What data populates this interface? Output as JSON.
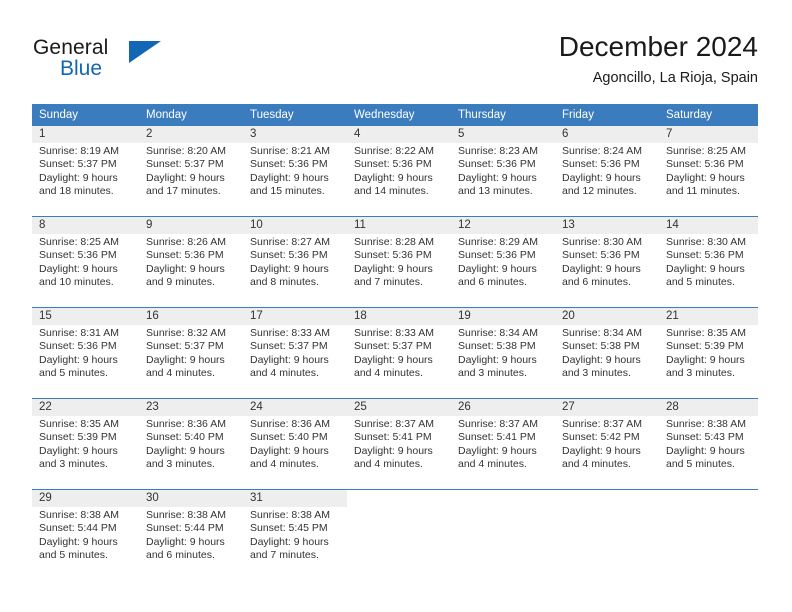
{
  "brand": {
    "name_part1": "General",
    "name_part2": "Blue",
    "flag_icon": "triangle-flag-icon"
  },
  "header": {
    "title": "December 2024",
    "location": "Agoncillo, La Rioja, Spain"
  },
  "calendar": {
    "weekday_headers": [
      "Sunday",
      "Monday",
      "Tuesday",
      "Wednesday",
      "Thursday",
      "Friday",
      "Saturday"
    ],
    "weeks": [
      [
        {
          "day": "1",
          "sunrise": "Sunrise: 8:19 AM",
          "sunset": "Sunset: 5:37 PM",
          "daylight_1": "Daylight: 9 hours",
          "daylight_2": "and 18 minutes."
        },
        {
          "day": "2",
          "sunrise": "Sunrise: 8:20 AM",
          "sunset": "Sunset: 5:37 PM",
          "daylight_1": "Daylight: 9 hours",
          "daylight_2": "and 17 minutes."
        },
        {
          "day": "3",
          "sunrise": "Sunrise: 8:21 AM",
          "sunset": "Sunset: 5:36 PM",
          "daylight_1": "Daylight: 9 hours",
          "daylight_2": "and 15 minutes."
        },
        {
          "day": "4",
          "sunrise": "Sunrise: 8:22 AM",
          "sunset": "Sunset: 5:36 PM",
          "daylight_1": "Daylight: 9 hours",
          "daylight_2": "and 14 minutes."
        },
        {
          "day": "5",
          "sunrise": "Sunrise: 8:23 AM",
          "sunset": "Sunset: 5:36 PM",
          "daylight_1": "Daylight: 9 hours",
          "daylight_2": "and 13 minutes."
        },
        {
          "day": "6",
          "sunrise": "Sunrise: 8:24 AM",
          "sunset": "Sunset: 5:36 PM",
          "daylight_1": "Daylight: 9 hours",
          "daylight_2": "and 12 minutes."
        },
        {
          "day": "7",
          "sunrise": "Sunrise: 8:25 AM",
          "sunset": "Sunset: 5:36 PM",
          "daylight_1": "Daylight: 9 hours",
          "daylight_2": "and 11 minutes."
        }
      ],
      [
        {
          "day": "8",
          "sunrise": "Sunrise: 8:25 AM",
          "sunset": "Sunset: 5:36 PM",
          "daylight_1": "Daylight: 9 hours",
          "daylight_2": "and 10 minutes."
        },
        {
          "day": "9",
          "sunrise": "Sunrise: 8:26 AM",
          "sunset": "Sunset: 5:36 PM",
          "daylight_1": "Daylight: 9 hours",
          "daylight_2": "and 9 minutes."
        },
        {
          "day": "10",
          "sunrise": "Sunrise: 8:27 AM",
          "sunset": "Sunset: 5:36 PM",
          "daylight_1": "Daylight: 9 hours",
          "daylight_2": "and 8 minutes."
        },
        {
          "day": "11",
          "sunrise": "Sunrise: 8:28 AM",
          "sunset": "Sunset: 5:36 PM",
          "daylight_1": "Daylight: 9 hours",
          "daylight_2": "and 7 minutes."
        },
        {
          "day": "12",
          "sunrise": "Sunrise: 8:29 AM",
          "sunset": "Sunset: 5:36 PM",
          "daylight_1": "Daylight: 9 hours",
          "daylight_2": "and 6 minutes."
        },
        {
          "day": "13",
          "sunrise": "Sunrise: 8:30 AM",
          "sunset": "Sunset: 5:36 PM",
          "daylight_1": "Daylight: 9 hours",
          "daylight_2": "and 6 minutes."
        },
        {
          "day": "14",
          "sunrise": "Sunrise: 8:30 AM",
          "sunset": "Sunset: 5:36 PM",
          "daylight_1": "Daylight: 9 hours",
          "daylight_2": "and 5 minutes."
        }
      ],
      [
        {
          "day": "15",
          "sunrise": "Sunrise: 8:31 AM",
          "sunset": "Sunset: 5:36 PM",
          "daylight_1": "Daylight: 9 hours",
          "daylight_2": "and 5 minutes."
        },
        {
          "day": "16",
          "sunrise": "Sunrise: 8:32 AM",
          "sunset": "Sunset: 5:37 PM",
          "daylight_1": "Daylight: 9 hours",
          "daylight_2": "and 4 minutes."
        },
        {
          "day": "17",
          "sunrise": "Sunrise: 8:33 AM",
          "sunset": "Sunset: 5:37 PM",
          "daylight_1": "Daylight: 9 hours",
          "daylight_2": "and 4 minutes."
        },
        {
          "day": "18",
          "sunrise": "Sunrise: 8:33 AM",
          "sunset": "Sunset: 5:37 PM",
          "daylight_1": "Daylight: 9 hours",
          "daylight_2": "and 4 minutes."
        },
        {
          "day": "19",
          "sunrise": "Sunrise: 8:34 AM",
          "sunset": "Sunset: 5:38 PM",
          "daylight_1": "Daylight: 9 hours",
          "daylight_2": "and 3 minutes."
        },
        {
          "day": "20",
          "sunrise": "Sunrise: 8:34 AM",
          "sunset": "Sunset: 5:38 PM",
          "daylight_1": "Daylight: 9 hours",
          "daylight_2": "and 3 minutes."
        },
        {
          "day": "21",
          "sunrise": "Sunrise: 8:35 AM",
          "sunset": "Sunset: 5:39 PM",
          "daylight_1": "Daylight: 9 hours",
          "daylight_2": "and 3 minutes."
        }
      ],
      [
        {
          "day": "22",
          "sunrise": "Sunrise: 8:35 AM",
          "sunset": "Sunset: 5:39 PM",
          "daylight_1": "Daylight: 9 hours",
          "daylight_2": "and 3 minutes."
        },
        {
          "day": "23",
          "sunrise": "Sunrise: 8:36 AM",
          "sunset": "Sunset: 5:40 PM",
          "daylight_1": "Daylight: 9 hours",
          "daylight_2": "and 3 minutes."
        },
        {
          "day": "24",
          "sunrise": "Sunrise: 8:36 AM",
          "sunset": "Sunset: 5:40 PM",
          "daylight_1": "Daylight: 9 hours",
          "daylight_2": "and 4 minutes."
        },
        {
          "day": "25",
          "sunrise": "Sunrise: 8:37 AM",
          "sunset": "Sunset: 5:41 PM",
          "daylight_1": "Daylight: 9 hours",
          "daylight_2": "and 4 minutes."
        },
        {
          "day": "26",
          "sunrise": "Sunrise: 8:37 AM",
          "sunset": "Sunset: 5:41 PM",
          "daylight_1": "Daylight: 9 hours",
          "daylight_2": "and 4 minutes."
        },
        {
          "day": "27",
          "sunrise": "Sunrise: 8:37 AM",
          "sunset": "Sunset: 5:42 PM",
          "daylight_1": "Daylight: 9 hours",
          "daylight_2": "and 4 minutes."
        },
        {
          "day": "28",
          "sunrise": "Sunrise: 8:38 AM",
          "sunset": "Sunset: 5:43 PM",
          "daylight_1": "Daylight: 9 hours",
          "daylight_2": "and 5 minutes."
        }
      ],
      [
        {
          "day": "29",
          "sunrise": "Sunrise: 8:38 AM",
          "sunset": "Sunset: 5:44 PM",
          "daylight_1": "Daylight: 9 hours",
          "daylight_2": "and 5 minutes."
        },
        {
          "day": "30",
          "sunrise": "Sunrise: 8:38 AM",
          "sunset": "Sunset: 5:44 PM",
          "daylight_1": "Daylight: 9 hours",
          "daylight_2": "and 6 minutes."
        },
        {
          "day": "31",
          "sunrise": "Sunrise: 8:38 AM",
          "sunset": "Sunset: 5:45 PM",
          "daylight_1": "Daylight: 9 hours",
          "daylight_2": "and 7 minutes."
        },
        {
          "day": "",
          "sunrise": "",
          "sunset": "",
          "daylight_1": "",
          "daylight_2": ""
        },
        {
          "day": "",
          "sunrise": "",
          "sunset": "",
          "daylight_1": "",
          "daylight_2": ""
        },
        {
          "day": "",
          "sunrise": "",
          "sunset": "",
          "daylight_1": "",
          "daylight_2": ""
        },
        {
          "day": "",
          "sunrise": "",
          "sunset": "",
          "daylight_1": "",
          "daylight_2": ""
        }
      ]
    ]
  },
  "colors": {
    "header_blue": "#3a7cbe",
    "brand_blue": "#1266b5",
    "daynum_band": "#eeeeee",
    "text": "#333333"
  }
}
